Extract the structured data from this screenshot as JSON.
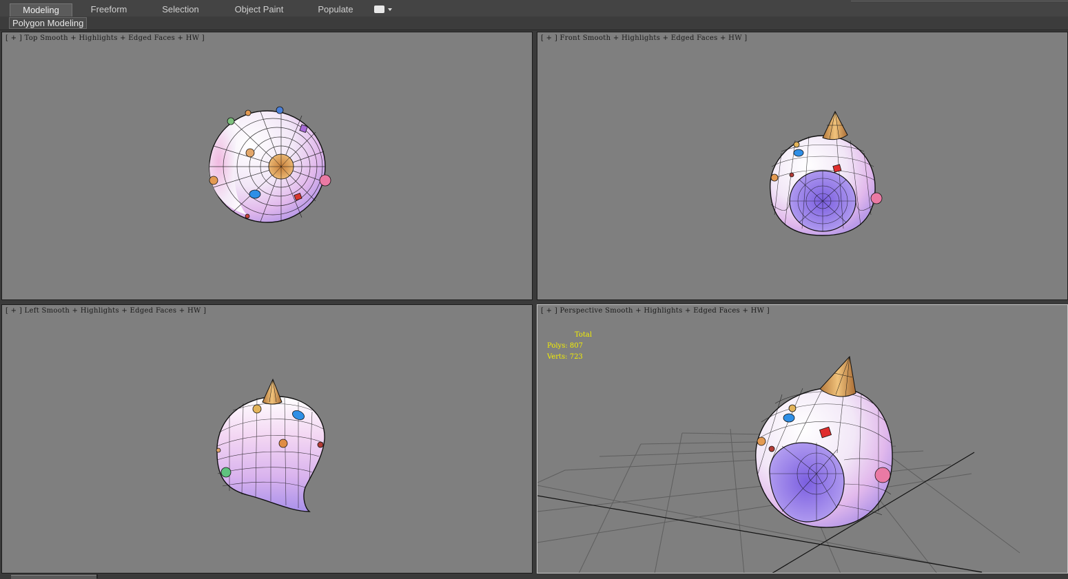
{
  "ribbon": {
    "tabs": [
      {
        "label": "Modeling",
        "active": true
      },
      {
        "label": "Freeform",
        "active": false
      },
      {
        "label": "Selection",
        "active": false
      },
      {
        "label": "Object Paint",
        "active": false
      },
      {
        "label": "Populate",
        "active": false
      }
    ],
    "panel_label": "Polygon Modeling"
  },
  "viewports": {
    "top": {
      "plus": "[ + ]",
      "name": "Top",
      "shading": "Smooth + Highlights + Edged Faces + HW",
      "close": "]"
    },
    "front": {
      "plus": "[ + ]",
      "name": "Front",
      "shading": "Smooth + Highlights + Edged Faces + HW",
      "close": "]"
    },
    "left": {
      "plus": "[ + ]",
      "name": "Left",
      "shading": "Smooth + Highlights + Edged Faces + HW",
      "close": "]"
    },
    "perspective": {
      "plus": "[ + ]",
      "name": "Perspective",
      "shading": "Smooth + Highlights + Edged Faces + HW",
      "close": "]",
      "stats": {
        "total_label": "Total",
        "polys": "Polys: 807",
        "verts": "Verts: 723"
      }
    }
  },
  "colors": {
    "viewport_bg": "#7f7f7f",
    "mesh_white": "#f4f0fb",
    "mesh_pink": "#e6b7e6",
    "mesh_purple": "#9b82e6",
    "cone": "#d9a25a",
    "stats_text": "#f4f000"
  }
}
